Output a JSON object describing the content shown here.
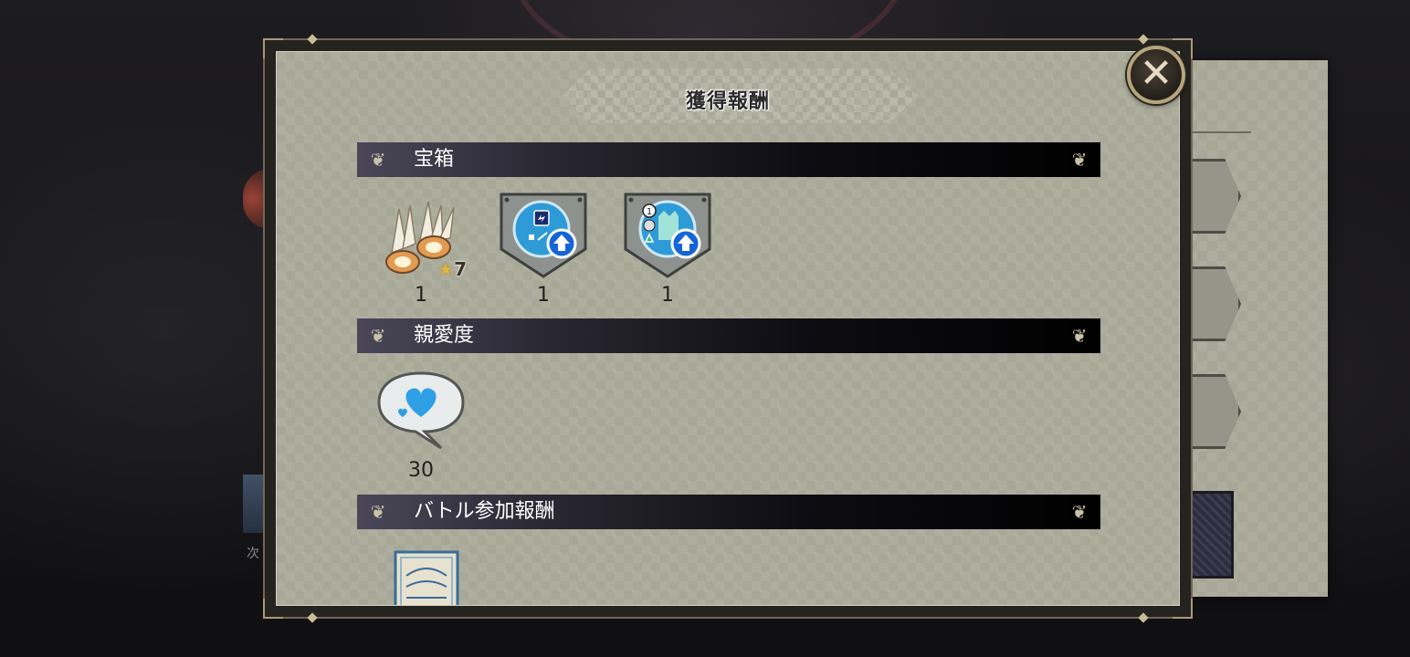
{
  "dialog": {
    "title": "獲得報酬",
    "close_label": "✕"
  },
  "sections": [
    {
      "label": "宝箱",
      "items": [
        {
          "name": "claw-material",
          "count": "1",
          "star": "7"
        },
        {
          "name": "skill-upgrade-badge",
          "count": "1"
        },
        {
          "name": "character-upgrade-badge",
          "count": "1"
        }
      ]
    },
    {
      "label": "親愛度",
      "items": [
        {
          "name": "affection-heart",
          "count": "30"
        }
      ]
    },
    {
      "label": "バトル参加報酬",
      "items": [
        {
          "name": "ticket-card"
        }
      ]
    }
  ],
  "icons": {
    "close": "close-icon",
    "section_ornament": "ornament-icon",
    "star": "star-icon",
    "upgrade_arrow": "arrow-up-icon"
  },
  "colors": {
    "panel": "#aeae9e",
    "section_bar": "#0e0d12",
    "frame_gold": "#b6a47c",
    "upgrade_blue": "#1565d8",
    "star_gold": "#e0b83a"
  }
}
